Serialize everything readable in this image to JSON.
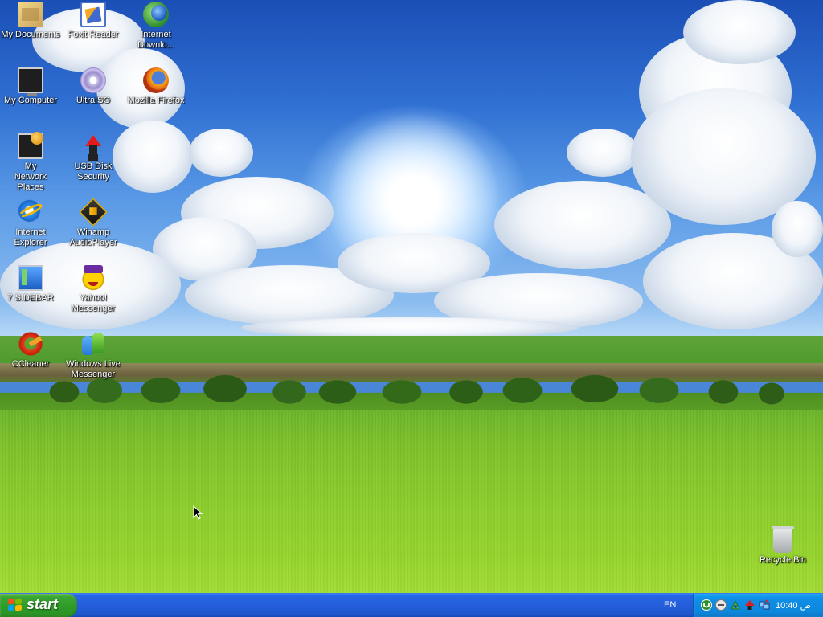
{
  "desktop": {
    "icons": [
      {
        "label": "My Documents",
        "icon": "folder-documents-icon"
      },
      {
        "label": "Foxit Reader",
        "icon": "foxit-reader-icon"
      },
      {
        "label": "Internet Downlo...",
        "icon": "internet-download-manager-icon"
      },
      {
        "label": "My Computer",
        "icon": "computer-icon"
      },
      {
        "label": "UltraISO",
        "icon": "ultraiso-disc-icon"
      },
      {
        "label": "Mozilla Firefox",
        "icon": "firefox-icon"
      },
      {
        "label": "My Network Places",
        "icon": "network-places-icon"
      },
      {
        "label": "USB Disk Security",
        "icon": "usb-disk-security-icon"
      },
      {
        "label": "Internet Explorer",
        "icon": "internet-explorer-icon"
      },
      {
        "label": "Winamp AudioPlayer",
        "icon": "winamp-icon"
      },
      {
        "label": "7 SIDEBAR",
        "icon": "sidebar-icon"
      },
      {
        "label": "Yahoo! Messenger",
        "icon": "yahoo-messenger-icon"
      },
      {
        "label": "CCleaner",
        "icon": "ccleaner-icon"
      },
      {
        "label": "Windows Live Messenger",
        "icon": "windows-live-messenger-icon"
      },
      {
        "label": "Recycle Bin",
        "icon": "recycle-bin-icon"
      }
    ]
  },
  "taskbar": {
    "start_label": "start",
    "language": "EN",
    "tray_icons": [
      "utorrent-icon",
      "volume-icon",
      "network-icon",
      "usb-security-icon",
      "network-activity-icon"
    ],
    "clock": "10:40 ص"
  },
  "colors": {
    "taskbar": "#245edb",
    "start_button": "#2d9b28",
    "tray": "#0e86db"
  }
}
